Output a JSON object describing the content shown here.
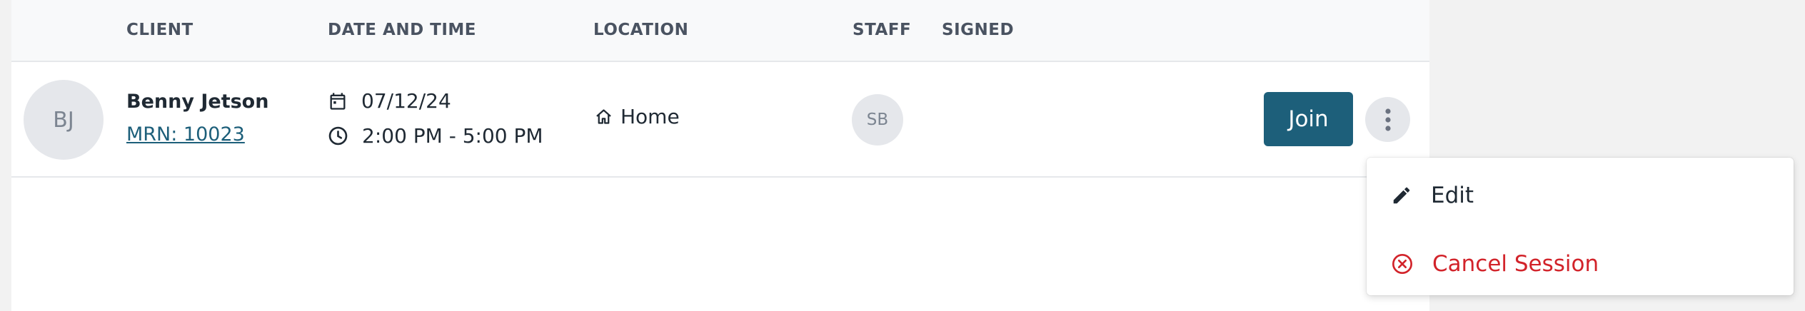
{
  "table": {
    "headers": {
      "client": "CLIENT",
      "date_time": "DATE AND TIME",
      "location": "LOCATION",
      "staff": "STAFF",
      "signed": "SIGNED"
    },
    "row": {
      "client_initials": "BJ",
      "client_name": "Benny Jetson",
      "mrn": "MRN: 10023",
      "date": "07/12/24",
      "time": "2:00 PM - 5:00 PM",
      "location": "Home",
      "staff_initials": "SB",
      "join_label": "Join"
    }
  },
  "menu": {
    "edit_label": "Edit",
    "cancel_label": "Cancel Session"
  },
  "colors": {
    "accent": "#1d5f7a",
    "danger": "#d2232a"
  },
  "icons": [
    "calendar-icon",
    "clock-icon",
    "home-icon",
    "kebab-menu-icon",
    "pencil-icon",
    "cancel-circle-icon"
  ]
}
